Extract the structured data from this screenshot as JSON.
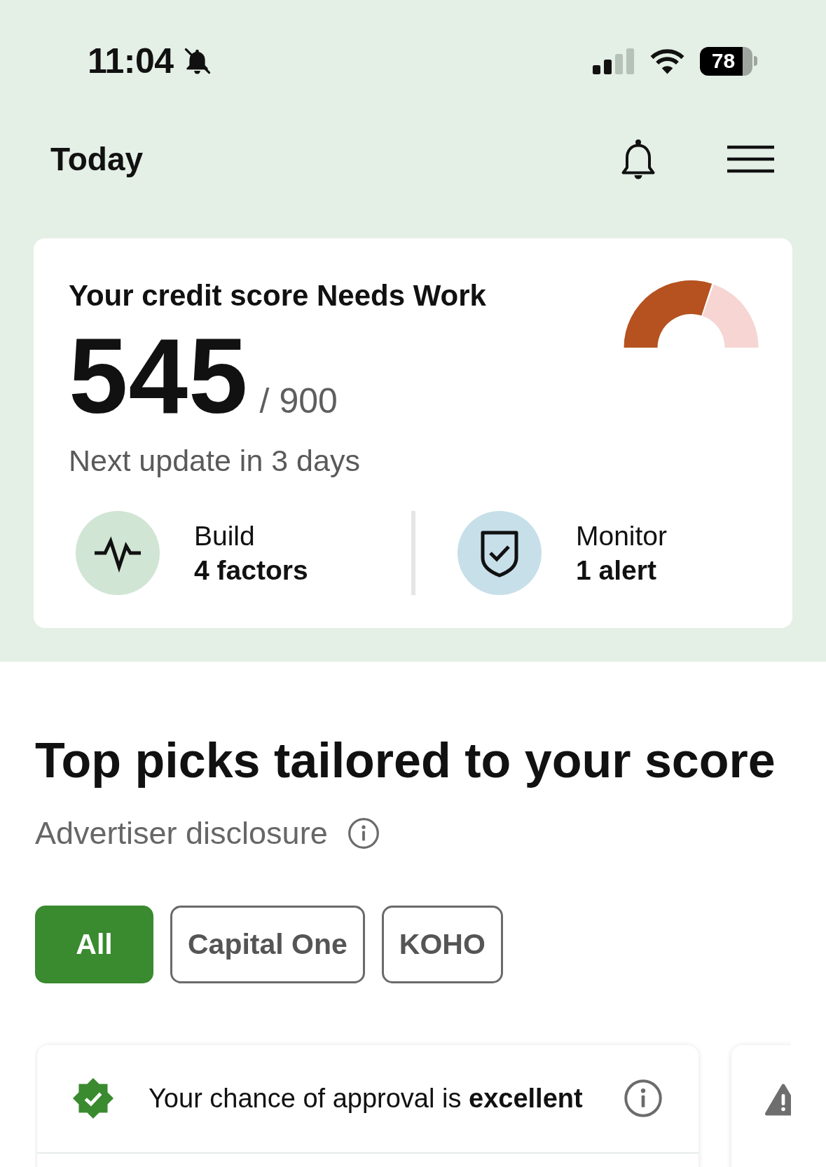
{
  "status_bar": {
    "time": "11:04",
    "silent": true,
    "battery": "78"
  },
  "header": {
    "title": "Today"
  },
  "score_card": {
    "title": "Your credit score Needs Work",
    "score": "545",
    "max": "/ 900",
    "next_update": "Next update in 3 days",
    "gauge": {
      "level": 0.6
    },
    "metrics": [
      {
        "kind": "build",
        "label": "Build",
        "value": "4 factors"
      },
      {
        "kind": "monitor",
        "label": "Monitor",
        "value": "1 alert"
      }
    ]
  },
  "top_picks": {
    "title": "Top picks tailored to your score",
    "disclosure": "Advertiser disclosure",
    "filters": [
      {
        "label": "All",
        "selected": true
      },
      {
        "label": "Capital One",
        "selected": false
      },
      {
        "label": "KOHO",
        "selected": false
      }
    ],
    "offers": [
      {
        "kind": "approval",
        "text": "Your chance of approval is **excellent**"
      },
      {
        "kind": "warning"
      }
    ]
  }
}
